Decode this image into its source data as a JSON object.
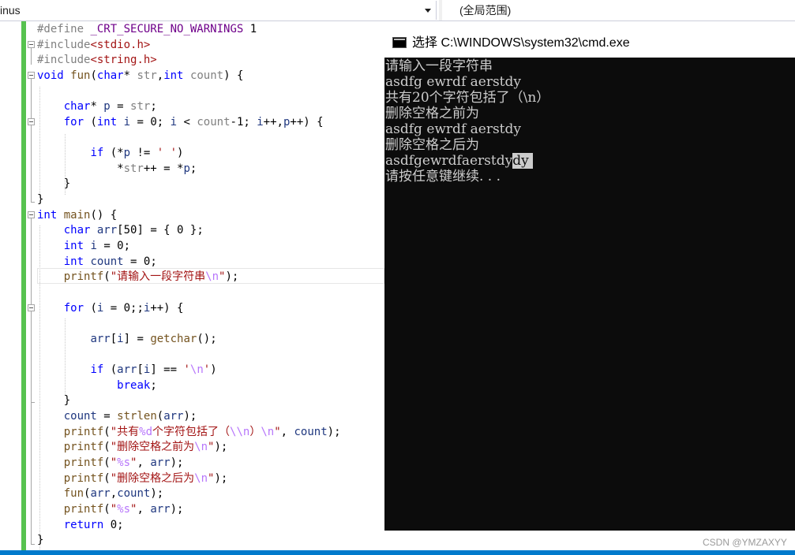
{
  "toolbar": {
    "scope_left": "inus",
    "scope_right": "(全局范围)"
  },
  "code": {
    "lines": [
      "#define _CRT_SECURE_NO_WARNINGS 1",
      "#include<stdio.h>",
      "#include<string.h>",
      "void fun(char* str,int count) {",
      "",
      "    char* p = str;",
      "    for (int i = 0; i < count-1; i++,p++) {",
      "",
      "        if (*p != ' ')",
      "            *str++ = *p;",
      "    }",
      "}",
      "int main() {",
      "    char arr[50] = { 0 };",
      "    int i = 0;",
      "    int count = 0;",
      "    printf(\"请输入一段字符串\\n\");",
      "",
      "    for (i = 0;;i++) {",
      "",
      "        arr[i] = getchar();",
      "",
      "        if (arr[i] == '\\n')",
      "            break;",
      "    }",
      "    count = strlen(arr);",
      "    printf(\"共有%d个字符包括了（\\\\n）\\n\", count);",
      "    printf(\"删除空格之前为\\n\");",
      "    printf(\"%s\", arr);",
      "    printf(\"删除空格之后为\\n\");",
      "    fun(arr,count);",
      "    printf(\"%s\", arr);",
      "    return 0;",
      "}"
    ]
  },
  "console": {
    "title": "选择 C:\\WINDOWS\\system32\\cmd.exe",
    "lines": [
      "请输入一段字符串",
      "asdfg ewrdf aerstdy",
      "共有20个字符包括了（\\n）",
      "删除空格之前为",
      "asdfg ewrdf aerstdy",
      "删除空格之后为",
      "asdfgewrdfaerstdy",
      "请按任意键继续. . ."
    ],
    "selected_tail": "dy "
  },
  "watermark": "CSDN @YMZAXYY"
}
